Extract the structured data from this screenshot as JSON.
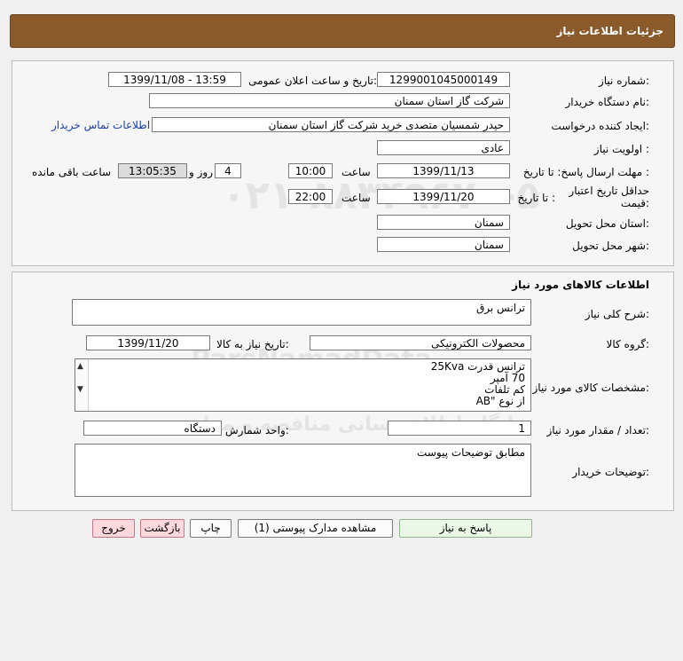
{
  "header": {
    "title": "جزئیات اطلاعات نیاز"
  },
  "need_info": {
    "need_number_label": "شماره نیاز:",
    "need_number": "1299001045000149",
    "announce_label": "تاریخ و ساعت اعلان عمومی:",
    "announce_value": "1399/11/08 - 13:59",
    "buyer_org_label": "نام دستگاه خریدار:",
    "buyer_org": "شرکت گاز استان سمنان",
    "creator_label": "ایجاد کننده درخواست:",
    "creator": "حیدر شمسیان متصدی خرید شرکت گاز استان سمنان",
    "contact_link": "اطلاعات تماس خریدار",
    "priority_label": "اولویت نیاز :",
    "priority": "عادی",
    "reply_deadline_label": "مهلت ارسال پاسخ: تا تاریخ :",
    "reply_date": "1399/11/13",
    "time_label": "ساعت",
    "reply_time": "10:00",
    "days_value": "4",
    "days_label": "روز و",
    "remaining_time": "13:05:35",
    "remaining_label": "ساعت باقی مانده",
    "price_validity_label": "حداقل تاریخ اعتبار قیمت:",
    "until_date_label": "تا تاریخ :",
    "price_date": "1399/11/20",
    "price_time": "22:00",
    "province_label": "استان محل تحویل:",
    "province": "سمنان",
    "city_label": "شهر محل تحویل:",
    "city": "سمنان"
  },
  "goods": {
    "section_title": "اطلاعات کالاهای مورد نیاز",
    "summary_label": "شرح کلی نیاز:",
    "summary": "ترانس برق",
    "group_label": "گروه کالا:",
    "group": "محصولات الکترونیکی",
    "need_date_label": "تاریخ نیاز به کالا:",
    "need_date": "1399/11/20",
    "specs_label": "مشخصات کالای مورد نیاز:",
    "specs": [
      "ترانس قدرت 25Kva",
      "70 آمپر",
      "کم تلفات",
      "از نوع \"AB"
    ],
    "qty_label": "تعداد / مقدار مورد نیاز:",
    "qty": "1",
    "unit_label": "واحد شمارش:",
    "unit": "دستگاه",
    "buyer_notes_label": "توضیحات خریدار:",
    "buyer_notes": "مطابق توضیحات پیوست"
  },
  "buttons": {
    "reply": "پاسخ به نیاز",
    "attachments": "مشاهده مدارک پیوستی (1)",
    "print": "چاپ",
    "back": "بازگشت",
    "exit": "خروج"
  },
  "watermark": {
    "brand": "ParsNamadData",
    "line1": "پایگاه اطلاع رسانی مناقصه و مزایده",
    "line2": "فرآوری اطلاعات پارس نماد داده ها",
    "phone": "۰۲۱-۸۸۳۴۹۶۷۰-۵"
  },
  "icons": {
    "scroll_up": "chevron-up-icon",
    "scroll_down": "chevron-down-icon"
  }
}
